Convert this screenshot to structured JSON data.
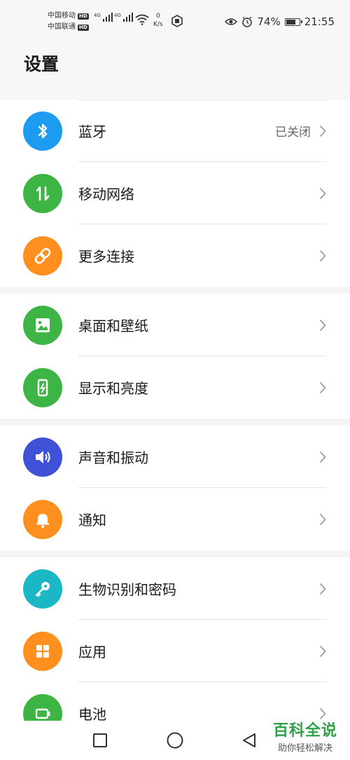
{
  "status_bar": {
    "carrier1": "中国移动",
    "carrier2": "中国联通",
    "hd": "HD",
    "net1": "4G",
    "net2": "4G",
    "speed_value": "0",
    "speed_unit": "K/s",
    "battery_percent": "74%",
    "battery_level": 0.74,
    "time": "21:55"
  },
  "header": {
    "title": "设置"
  },
  "groups": [
    {
      "items": [
        {
          "label": "蓝牙",
          "value": "已关闭",
          "icon": "bluetooth-icon",
          "color": "#1d9bf0"
        },
        {
          "label": "移动网络",
          "icon": "mobile-data-icon",
          "color": "#3cb545"
        },
        {
          "label": "更多连接",
          "icon": "link-icon",
          "color": "#ff8f1f"
        }
      ]
    },
    {
      "items": [
        {
          "label": "桌面和壁纸",
          "icon": "image-icon",
          "color": "#3cb545"
        },
        {
          "label": "显示和亮度",
          "icon": "display-icon",
          "color": "#3cb545"
        }
      ]
    },
    {
      "items": [
        {
          "label": "声音和振动",
          "icon": "speaker-icon",
          "color": "#3f51d6"
        },
        {
          "label": "通知",
          "icon": "bell-icon",
          "color": "#ff8f1f"
        }
      ]
    },
    {
      "items": [
        {
          "label": "生物识别和密码",
          "icon": "key-icon",
          "color": "#1ab8c4"
        },
        {
          "label": "应用",
          "icon": "apps-icon",
          "color": "#ff8f1f"
        },
        {
          "label": "电池",
          "icon": "battery-icon",
          "color": "#3cb545"
        }
      ]
    }
  ],
  "watermark": {
    "title": "百科全说",
    "subtitle": "助你轻松解决"
  },
  "colors": {
    "chevron": "#9e9e9e",
    "divider": "#e6e6e6",
    "watermark": "#2ea14a"
  }
}
